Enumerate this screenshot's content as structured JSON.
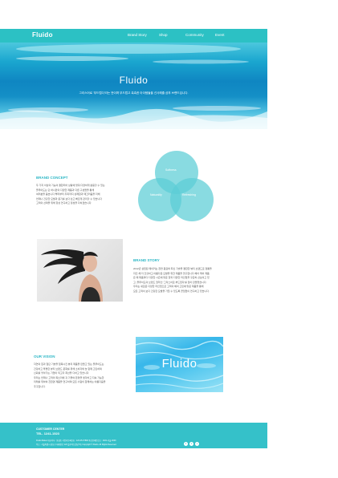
{
  "header": {
    "logo": "Fluido",
    "nav": [
      "Brand Story",
      "Shop",
      "Community",
      "Event"
    ]
  },
  "hero": {
    "title": "Fluido",
    "subtitle": "그리스어로 '부드럽다'라는 뜻이며 부드럽고 촉촉한 아이템들을 선사해줄 샴푸 브랜드입니다."
  },
  "concept": {
    "title": "BRAND CONCEPT",
    "lines": [
      "두 가지 이상의 기능이 결합되어 상황에 맞춰 다양하게 활용할 수 있는",
      "플루이도는 단 하나만의 다양한 제품과 다른 구성들을 통해",
      "여러분을 돕습니다 뿌리부터 두피까지 상쾌함과 매끄러움을 더해",
      "언제나 건강한 모발과 윤기를 보다 쉽고 빠르게 관리할 수 있습니다",
      "고객의 선택을 위해 항상 연구하고 정성을 다하겠습니다."
    ],
    "venn": [
      "Softness",
      "Naturality",
      "Refreshing"
    ]
  },
  "story": {
    "title": "BRAND STORY",
    "lines": [
      "2012년 설립된 메이커는 천연 원료와 최신 기술을 결합한 뷰티 브랜드로 정통을",
      "지킨 채 더 건강하고 아름다운 모발을 위한 제품을 연구합니다 헤어 케어 제품",
      "은 매 제품마다 다양한 시즌에 맞춘 향과 다양한 라인업을 꾸준히 선보이고 있",
      "고, 플루이도의 브랜드 철학인 '그리스어로 부드럽다'를 담아 만들었습니다.",
      "",
      "우리는 새로운 다양한 라인업으로 고객의 헤어 고민에 맞춘 제품을 통해",
      "모든 고객이 보다 건강한 모발을 가질 수 있도록 끊임없이 연구하고 있습니다."
    ]
  },
  "vision": {
    "title": "OUR VISION",
    "lines": [
      "자연의 힘과 첨단 기술을 접목시킨 뷰티 제품을 만들고 있는 플루이도는",
      "건강하고 투명한 뷰티 브랜드 문화를 위해 소비자와 늘 함께 고민하며",
      "신뢰를 쌓아가는 기업이 되고자 최선을 다하고 있습니다.",
      "",
      "우리는 언제나 고객의 목소리에 귀 기울여 환경을 생각하고 지속 가능한",
      "미래를 위하여 친환경 제품을 연구하며 모든 사람이 함께하는 아름다움을",
      "추구합니다."
    ],
    "image_logo": "Fluido"
  },
  "footer": {
    "center_label": "CUSTOMER CENTER",
    "phone": "TEL. 1241-1523",
    "line1": "Fluido Maker    대표이사 : 홍길동    사업자등록번호 : 123-45-67890    통신판매업신고 : 2021-서울-0000",
    "line2": "주소 : 서울특별시 강남구 테헤란로 123 플루이도빌딩 5층    Copyright © Fluido. All Rights Reserved.",
    "sns": [
      "f",
      "t",
      "i"
    ]
  },
  "colors": {
    "accent": "#2cc1c4",
    "title_accent": "#2db7c6",
    "footer_bg": "#35c1c9"
  }
}
